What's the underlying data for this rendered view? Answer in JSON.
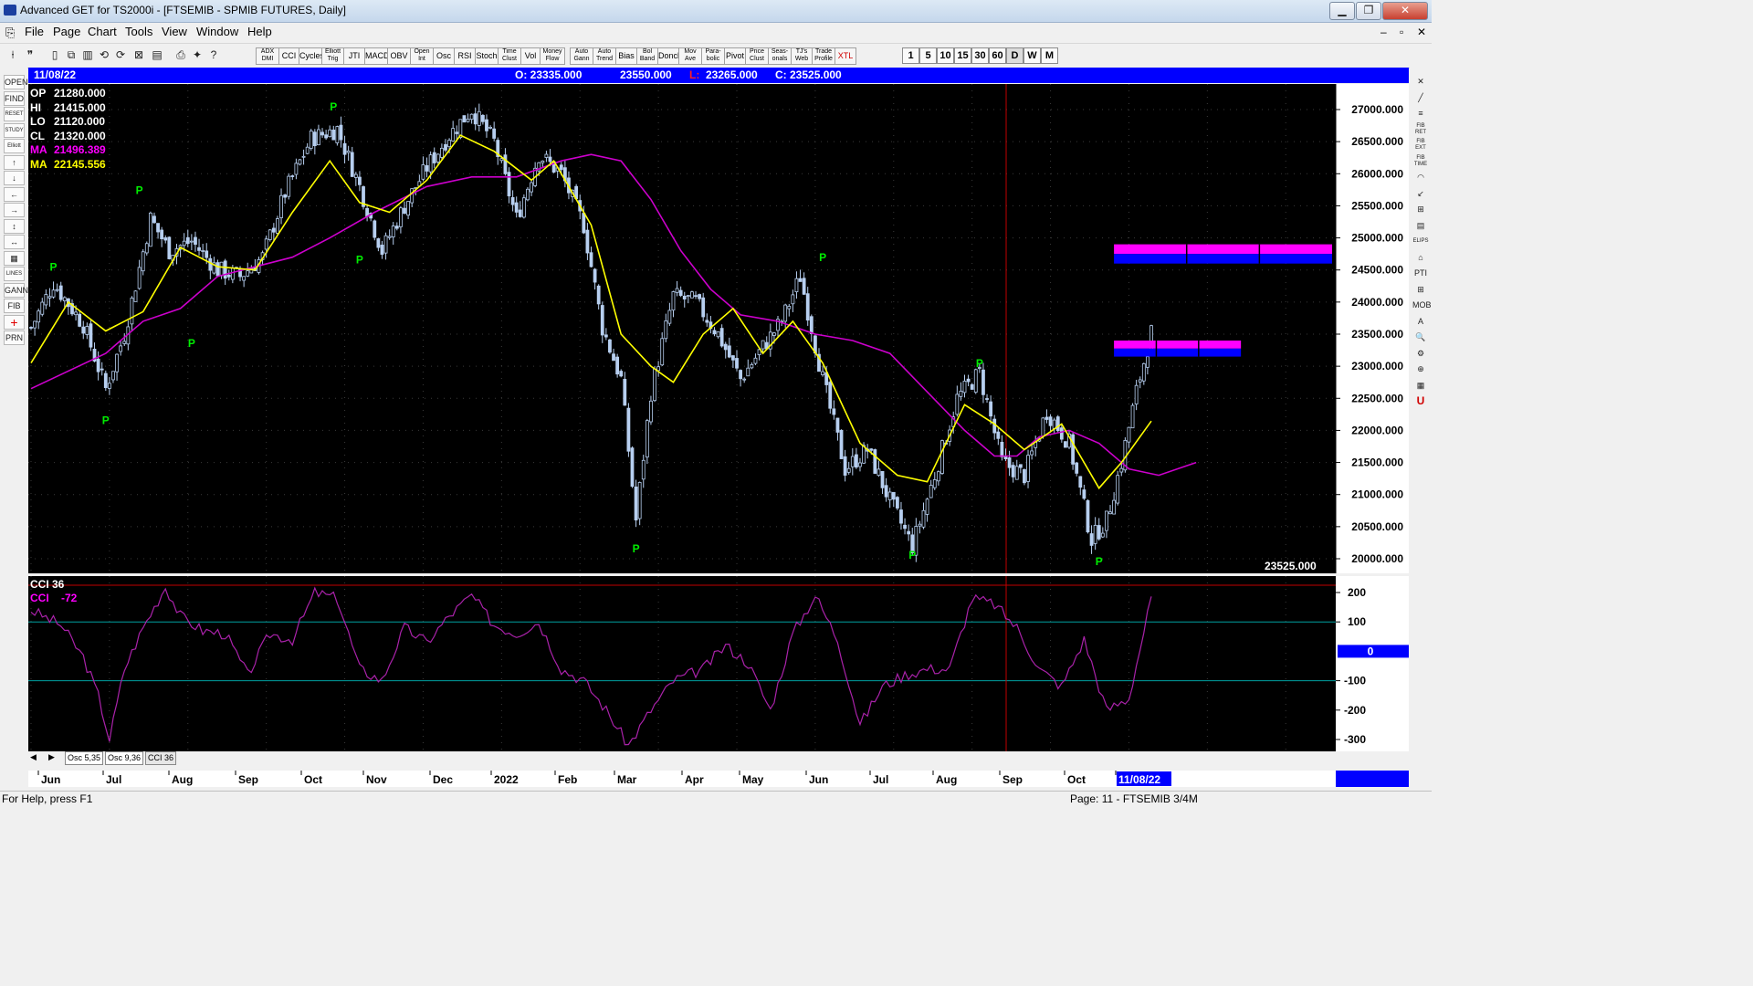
{
  "window": {
    "title": "Advanced GET for TS2000i - [FTSEMIB - SPMIB FUTURES, Daily]",
    "min_label": "▁",
    "max_label": "❐",
    "close_label": "✕",
    "child_min": "–",
    "child_restore": "▫",
    "child_close": "✕"
  },
  "menu": [
    "File",
    "Page",
    "Chart",
    "Tools",
    "View",
    "Window",
    "Help"
  ],
  "toolbar": {
    "studies": [
      {
        "label": "ADX\nDMI"
      },
      {
        "label": "CCI"
      },
      {
        "label": "Cycles"
      },
      {
        "label": "Elliott\nTrig"
      },
      {
        "label": "JTI"
      },
      {
        "label": "MACD"
      },
      {
        "label": "OBV"
      },
      {
        "label": "Open\nInt"
      },
      {
        "label": "Osc"
      },
      {
        "label": "RSI"
      },
      {
        "label": "Stoch"
      },
      {
        "label": "Time\nClust"
      },
      {
        "label": "Vol"
      },
      {
        "label": "Money\nFlow"
      },
      {
        "label": "Auto\nGann"
      },
      {
        "label": "Auto\nTrend"
      },
      {
        "label": "Bias"
      },
      {
        "label": "Bol\nBand"
      },
      {
        "label": "Donch"
      },
      {
        "label": "Mov\nAve"
      },
      {
        "label": "Para-\nbolic"
      },
      {
        "label": "Pivot"
      },
      {
        "label": "Price\nClust"
      },
      {
        "label": "Seas-\nonals"
      },
      {
        "label": "TJ's\nWeb"
      },
      {
        "label": "Trade\nProfile"
      },
      {
        "label": "XTL"
      }
    ],
    "timeframes": [
      "1",
      "5",
      "10",
      "15",
      "30",
      "60",
      "D",
      "W",
      "M"
    ]
  },
  "left_tools": [
    "OPEN",
    "FIND",
    "RESET",
    "STUDY",
    "Elliott",
    "↑",
    "↓",
    "←",
    "→",
    "↕",
    "↔",
    "▦",
    "LINES",
    "GANN",
    "FIB",
    "+",
    "PRN"
  ],
  "right_tools": [
    "✕",
    "╱",
    "≡",
    "FIB\nRET",
    "FIB\nEXT",
    "FIB\nTIME",
    "◠",
    "↙",
    "⊞",
    "▤",
    "ELIPS",
    "⌂",
    "PTI",
    "⊞",
    "MOB",
    "A",
    "🔍",
    "⚙",
    "⊕",
    "▦",
    "U"
  ],
  "info": {
    "date": "11/08/22",
    "open": "O: 23335.000",
    "high": "23550.000",
    "low_key": "L:",
    "low_val": "23265.000",
    "close": "C: 23525.000"
  },
  "legend": [
    {
      "label": "OP",
      "value": "21280.000",
      "color": "#ffffff"
    },
    {
      "label": "HI",
      "value": "21415.000",
      "color": "#ffffff"
    },
    {
      "label": "LO",
      "value": "21120.000",
      "color": "#ffffff"
    },
    {
      "label": "CL",
      "value": "21320.000",
      "color": "#ffffff"
    },
    {
      "label": "MA",
      "value": "21496.389",
      "color": "#ff00ff"
    },
    {
      "label": "MA",
      "value": "22145.556",
      "color": "#ffff00"
    }
  ],
  "last_price_label": "23525.000",
  "cci_legend": {
    "name": "CCI 36",
    "label": "CCI",
    "value": "-72"
  },
  "tabs": [
    "Osc 5,35",
    "Osc 9,36",
    "CCI 36"
  ],
  "status": {
    "left": "For Help, press F1",
    "right": "Page: 11 - FTSEMIB 3/4M"
  },
  "colors": {
    "background": "#000000",
    "candles": "#b7cff0",
    "ma_fast": "#ffff00",
    "ma_slow": "#cc00cc",
    "cci": "#aa22aa",
    "pivot": "#00ee00",
    "band_magenta": "#ff00ff",
    "band_blue": "#0000ff",
    "accent": "#0000ff"
  },
  "chart_data": [
    {
      "type": "candlestick",
      "title": "FTSEMIB - SPMIB FUTURES, Daily",
      "x": [
        "Jun",
        "Jul",
        "Aug",
        "Sep",
        "Oct",
        "Nov",
        "Dec",
        "2022",
        "Feb",
        "Mar",
        "Apr",
        "May",
        "Jun",
        "Jul",
        "Aug",
        "Sep",
        "Oct",
        "11/08/22"
      ],
      "ylim": [
        20000,
        27000
      ],
      "yticks": [
        "27000.000",
        "26500.000",
        "26000.000",
        "25500.000",
        "25000.000",
        "24500.000",
        "24000.000",
        "23500.000",
        "23000.000",
        "22500.000",
        "22000.000",
        "21500.000",
        "21000.000",
        "20500.000",
        "20000.000"
      ],
      "close_path": [
        [
          0,
          23600
        ],
        [
          6,
          24300
        ],
        [
          14,
          23650
        ],
        [
          20,
          22650
        ],
        [
          25,
          23500
        ],
        [
          32,
          25300
        ],
        [
          37,
          24800
        ],
        [
          43,
          24950
        ],
        [
          50,
          24500
        ],
        [
          56,
          24400
        ],
        [
          62,
          24700
        ],
        [
          68,
          25700
        ],
        [
          75,
          26550
        ],
        [
          82,
          26700
        ],
        [
          88,
          25800
        ],
        [
          94,
          24800
        ],
        [
          100,
          25500
        ],
        [
          106,
          26100
        ],
        [
          112,
          26600
        ],
        [
          118,
          27000
        ],
        [
          124,
          26500
        ],
        [
          130,
          25300
        ],
        [
          136,
          26300
        ],
        [
          142,
          26000
        ],
        [
          148,
          25200
        ],
        [
          153,
          23600
        ],
        [
          158,
          22800
        ],
        [
          162,
          20600
        ],
        [
          166,
          22600
        ],
        [
          172,
          24100
        ],
        [
          178,
          24000
        ],
        [
          184,
          23500
        ],
        [
          190,
          22800
        ],
        [
          196,
          23300
        ],
        [
          201,
          23700
        ],
        [
          206,
          24400
        ],
        [
          212,
          22800
        ],
        [
          218,
          21400
        ],
        [
          224,
          21700
        ],
        [
          230,
          20900
        ],
        [
          236,
          20200
        ],
        [
          242,
          21300
        ],
        [
          248,
          22500
        ],
        [
          254,
          22900
        ],
        [
          260,
          21500
        ],
        [
          266,
          21300
        ],
        [
          272,
          22300
        ],
        [
          278,
          21800
        ],
        [
          284,
          20300
        ],
        [
          288,
          20600
        ],
        [
          292,
          21500
        ],
        [
          296,
          22600
        ],
        [
          300,
          23525
        ]
      ],
      "ma_fast": [
        [
          0,
          23050
        ],
        [
          10,
          24000
        ],
        [
          20,
          23550
        ],
        [
          30,
          23850
        ],
        [
          40,
          24850
        ],
        [
          50,
          24550
        ],
        [
          60,
          24500
        ],
        [
          70,
          25400
        ],
        [
          80,
          26200
        ],
        [
          88,
          25550
        ],
        [
          96,
          25400
        ],
        [
          106,
          25900
        ],
        [
          115,
          26600
        ],
        [
          124,
          26350
        ],
        [
          134,
          25900
        ],
        [
          140,
          26200
        ],
        [
          150,
          25200
        ],
        [
          158,
          23500
        ],
        [
          166,
          23000
        ],
        [
          172,
          22750
        ],
        [
          180,
          23500
        ],
        [
          188,
          23900
        ],
        [
          196,
          23200
        ],
        [
          204,
          23700
        ],
        [
          212,
          23050
        ],
        [
          222,
          21800
        ],
        [
          232,
          21300
        ],
        [
          240,
          21200
        ],
        [
          250,
          22400
        ],
        [
          258,
          22100
        ],
        [
          266,
          21700
        ],
        [
          276,
          22100
        ],
        [
          286,
          21100
        ],
        [
          292,
          21500
        ],
        [
          300,
          22145
        ]
      ],
      "ma_slow": [
        [
          0,
          22650
        ],
        [
          20,
          23200
        ],
        [
          30,
          23700
        ],
        [
          40,
          23900
        ],
        [
          50,
          24400
        ],
        [
          60,
          24550
        ],
        [
          70,
          24700
        ],
        [
          80,
          25000
        ],
        [
          92,
          25400
        ],
        [
          106,
          25800
        ],
        [
          118,
          25950
        ],
        [
          130,
          25950
        ],
        [
          142,
          26200
        ],
        [
          150,
          26300
        ],
        [
          158,
          26200
        ],
        [
          166,
          25600
        ],
        [
          174,
          24800
        ],
        [
          182,
          24200
        ],
        [
          190,
          23800
        ],
        [
          200,
          23700
        ],
        [
          210,
          23500
        ],
        [
          220,
          23400
        ],
        [
          230,
          23200
        ],
        [
          240,
          22600
        ],
        [
          250,
          22000
        ],
        [
          258,
          21600
        ],
        [
          264,
          21600
        ],
        [
          270,
          21900
        ],
        [
          278,
          22000
        ],
        [
          286,
          21800
        ],
        [
          294,
          21400
        ],
        [
          302,
          21300
        ],
        [
          312,
          21500
        ]
      ],
      "pivots": [
        {
          "bar": 6,
          "price": 24400,
          "label": "P",
          "pos": "above"
        },
        {
          "bar": 29,
          "price": 25600,
          "label": "P",
          "pos": "above"
        },
        {
          "bar": 20,
          "price": 22300,
          "label": "P",
          "pos": "below"
        },
        {
          "bar": 43,
          "price": 23500,
          "label": "P",
          "pos": "below"
        },
        {
          "bar": 81,
          "price": 26900,
          "label": "P",
          "pos": "above"
        },
        {
          "bar": 88,
          "price": 24800,
          "label": "P",
          "pos": "below"
        },
        {
          "bar": 162,
          "price": 20300,
          "label": "P",
          "pos": "below"
        },
        {
          "bar": 212,
          "price": 24550,
          "label": "P",
          "pos": "above"
        },
        {
          "bar": 236,
          "price": 20200,
          "label": "P",
          "pos": "below"
        },
        {
          "bar": 254,
          "price": 22900,
          "label": "P",
          "pos": "above"
        },
        {
          "bar": 286,
          "price": 20100,
          "label": "P",
          "pos": "below"
        }
      ],
      "target_bands": [
        {
          "from_bar": 290,
          "to_bar": 360,
          "top": 24900,
          "bottom": 24600
        },
        {
          "from_bar": 290,
          "to_bar": 324,
          "top": 23400,
          "bottom": 23150
        }
      ]
    },
    {
      "type": "line",
      "title": "CCI 36",
      "ylim": [
        -300,
        200
      ],
      "yticks": [
        "200",
        "100",
        "0",
        "-100",
        "-200",
        "-300"
      ],
      "series": [
        {
          "name": "CCI",
          "values": [
            [
              0,
              140
            ],
            [
              8,
              90
            ],
            [
              14,
              -20
            ],
            [
              18,
              -150
            ],
            [
              21,
              -300
            ],
            [
              25,
              -60
            ],
            [
              30,
              80
            ],
            [
              36,
              220
            ],
            [
              40,
              120
            ],
            [
              46,
              70
            ],
            [
              52,
              60
            ],
            [
              58,
              -80
            ],
            [
              64,
              60
            ],
            [
              70,
              40
            ],
            [
              76,
              200
            ],
            [
              82,
              180
            ],
            [
              88,
              -60
            ],
            [
              94,
              -100
            ],
            [
              100,
              80
            ],
            [
              106,
              30
            ],
            [
              112,
              120
            ],
            [
              118,
              190
            ],
            [
              124,
              90
            ],
            [
              130,
              60
            ],
            [
              136,
              100
            ],
            [
              142,
              -60
            ],
            [
              148,
              -100
            ],
            [
              154,
              -200
            ],
            [
              160,
              -320
            ],
            [
              166,
              -200
            ],
            [
              172,
              -100
            ],
            [
              180,
              -60
            ],
            [
              186,
              20
            ],
            [
              192,
              -40
            ],
            [
              198,
              -200
            ],
            [
              204,
              60
            ],
            [
              210,
              190
            ],
            [
              216,
              40
            ],
            [
              222,
              -250
            ],
            [
              228,
              -120
            ],
            [
              234,
              -80
            ],
            [
              240,
              -60
            ],
            [
              246,
              -60
            ],
            [
              252,
              180
            ],
            [
              258,
              160
            ],
            [
              264,
              80
            ],
            [
              270,
              -60
            ],
            [
              276,
              -120
            ],
            [
              282,
              40
            ],
            [
              288,
              -200
            ],
            [
              294,
              -160
            ],
            [
              300,
              180
            ]
          ]
        }
      ]
    }
  ]
}
